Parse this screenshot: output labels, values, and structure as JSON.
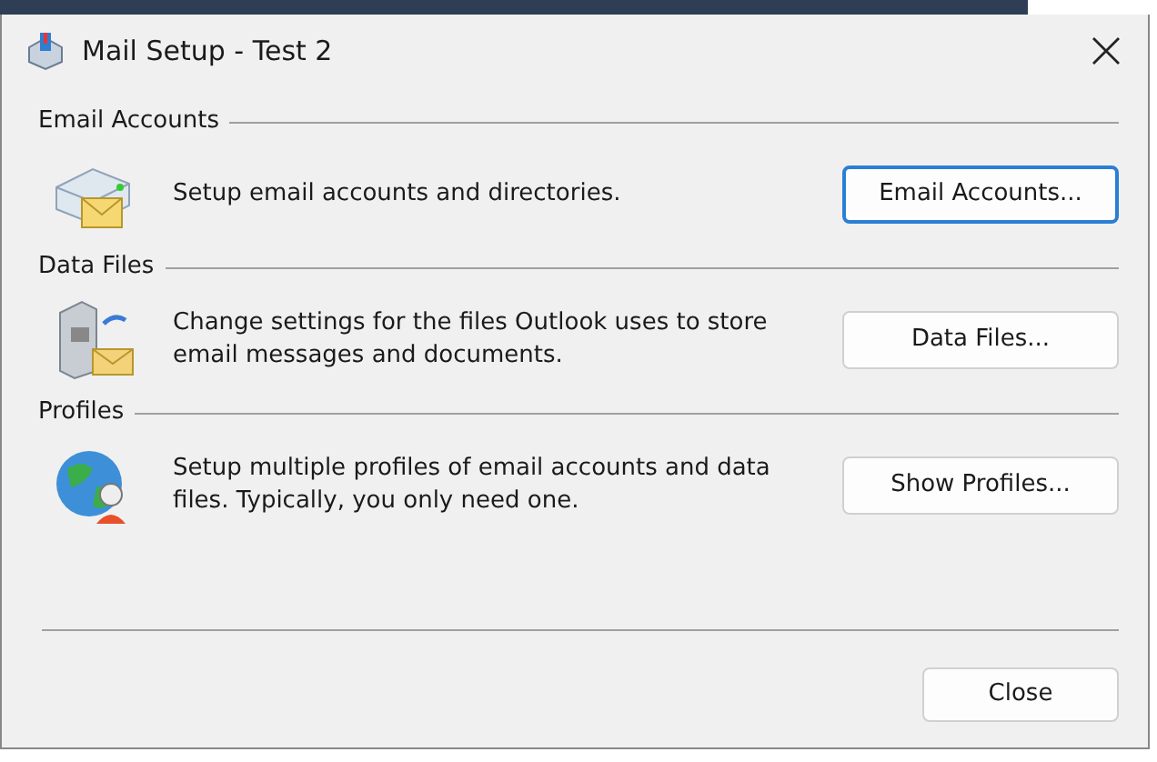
{
  "window": {
    "title": "Mail Setup - Test 2"
  },
  "sections": [
    {
      "kind": "accounts",
      "heading": "Email Accounts",
      "description": "Setup email accounts and directories.",
      "button": {
        "label": "Email Accounts...",
        "focused": true
      }
    },
    {
      "kind": "datafiles",
      "heading": "Data Files",
      "description": "Change settings for the files Outlook uses to store email messages and documents.",
      "button": {
        "label": "Data Files...",
        "focused": false
      }
    },
    {
      "kind": "profiles",
      "heading": "Profiles",
      "description": "Setup multiple profiles of email accounts and data files. Typically, you only need one.",
      "button": {
        "label": "Show Profiles...",
        "focused": false
      }
    }
  ],
  "footer": {
    "button": {
      "label": "Close"
    }
  }
}
